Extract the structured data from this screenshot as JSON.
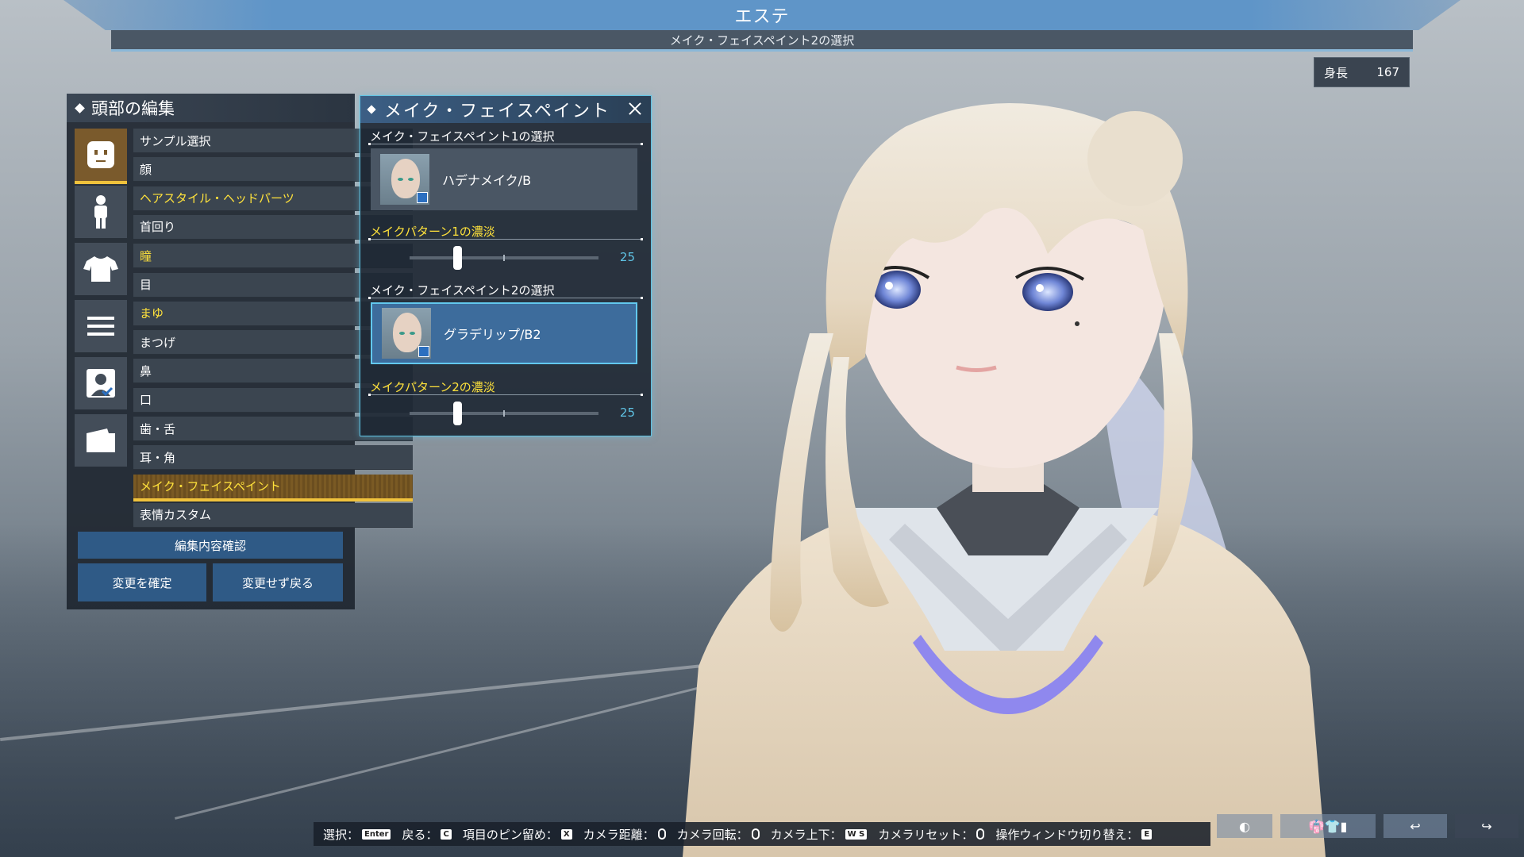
{
  "banner": {
    "title": "エステ",
    "subtitle": "メイク・フェイスペイント2の選択"
  },
  "height": {
    "label": "身長",
    "value": "167"
  },
  "left_panel": {
    "title": "頭部の編集",
    "categories": [
      {
        "icon": "face-icon"
      },
      {
        "icon": "body-icon"
      },
      {
        "icon": "shirt-icon"
      },
      {
        "icon": "menu-icon"
      },
      {
        "icon": "profile-icon"
      },
      {
        "icon": "folder-icon"
      }
    ],
    "items": [
      {
        "label": "サンプル選択",
        "style": "normal"
      },
      {
        "label": "顔",
        "style": "normal"
      },
      {
        "label": "ヘアスタイル・ヘッドパーツ",
        "style": "yellow"
      },
      {
        "label": "首回り",
        "style": "normal"
      },
      {
        "label": "瞳",
        "style": "yellow"
      },
      {
        "label": "目",
        "style": "normal"
      },
      {
        "label": "まゆ",
        "style": "yellow"
      },
      {
        "label": "まつげ",
        "style": "normal"
      },
      {
        "label": "鼻",
        "style": "normal"
      },
      {
        "label": "口",
        "style": "normal"
      },
      {
        "label": "歯・舌",
        "style": "normal"
      },
      {
        "label": "耳・角",
        "style": "normal"
      },
      {
        "label": "メイク・フェイスペイント",
        "style": "selected"
      },
      {
        "label": "表情カスタム",
        "style": "normal"
      }
    ],
    "review_button": "編集内容確認",
    "confirm_button": "変更を確定",
    "cancel_button": "変更せず戻る"
  },
  "makeup_panel": {
    "title": "メイク・フェイスペイント",
    "section1_label": "メイク・フェイスペイント1の選択",
    "paint1_name": "ハデナメイク/B",
    "pattern1_label": "メイクパターン1の濃淡",
    "pattern1_value": 25,
    "section2_label": "メイク・フェイスペイント2の選択",
    "paint2_name": "グラデリップ/B2",
    "pattern2_label": "メイクパターン2の濃淡",
    "pattern2_value": 25,
    "slider_max": 100
  },
  "bottom_hints": {
    "select": "選択：",
    "select_key": "Enter",
    "back": "戻る：",
    "back_key": "C",
    "pin": "項目のピン留め：",
    "pin_key": "X",
    "distance": "カメラ距離：",
    "rotate": "カメラ回転：",
    "updown": "カメラ上下：",
    "updown_key": "W S",
    "reset": "カメラリセット：",
    "switch": "操作ウィンドウ切り替え：",
    "switch_key": "E"
  },
  "colors": {
    "accent_yellow": "#ffe23b",
    "accent_cyan": "#5fc3e4",
    "selected_bar": "#f0c23c"
  }
}
